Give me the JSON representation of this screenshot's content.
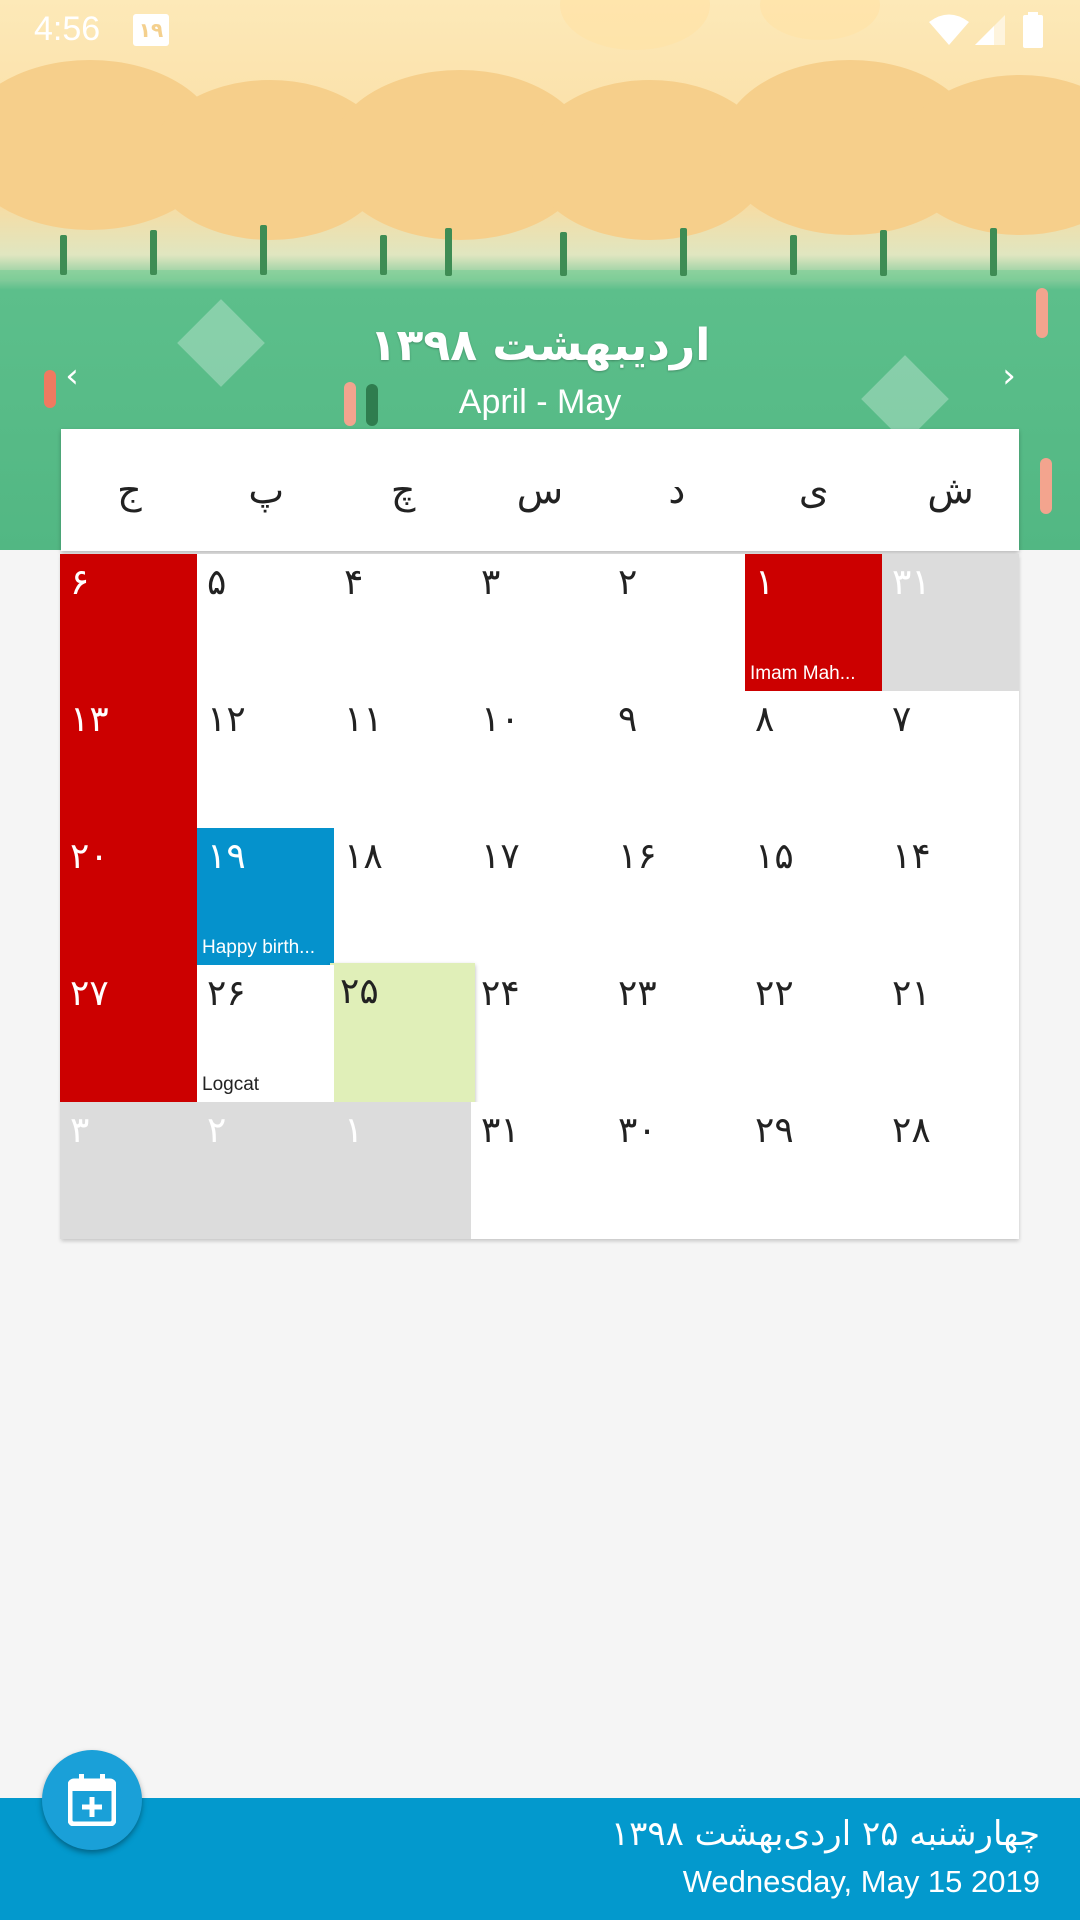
{
  "status_bar": {
    "time": "4:56",
    "date_badge": "۱۹",
    "icons": [
      "wifi-icon",
      "signal-icon",
      "battery-icon"
    ]
  },
  "header": {
    "title_persian": "اردیبهشت ۱۳۹۸",
    "subtitle": "April - May",
    "prev_icon": "chevron-left-icon",
    "next_icon": "chevron-right-icon"
  },
  "week_days": [
    "ش",
    "ی",
    "د",
    "س",
    "چ",
    "پ",
    "ج"
  ],
  "weeks": [
    [
      {
        "day": "۳۱",
        "type": "other"
      },
      {
        "day": "۱",
        "type": "holiday",
        "event": "Imam Mah..."
      },
      {
        "day": "۲"
      },
      {
        "day": "۳"
      },
      {
        "day": "۴"
      },
      {
        "day": "۵"
      },
      {
        "day": "۶",
        "type": "holiday"
      }
    ],
    [
      {
        "day": "۷"
      },
      {
        "day": "۸"
      },
      {
        "day": "۹"
      },
      {
        "day": "۱۰"
      },
      {
        "day": "۱۱"
      },
      {
        "day": "۱۲"
      },
      {
        "day": "۱۳",
        "type": "holiday"
      }
    ],
    [
      {
        "day": "۱۴"
      },
      {
        "day": "۱۵"
      },
      {
        "day": "۱۶"
      },
      {
        "day": "۱۷"
      },
      {
        "day": "۱۸"
      },
      {
        "day": "۱۹",
        "type": "birthday",
        "event": "Happy birth..."
      },
      {
        "day": "۲۰",
        "type": "holiday"
      }
    ],
    [
      {
        "day": "۲۱"
      },
      {
        "day": "۲۲"
      },
      {
        "day": "۲۳"
      },
      {
        "day": "۲۴"
      },
      {
        "day": "۲۵",
        "type": "today"
      },
      {
        "day": "۲۶",
        "type": "logcat",
        "event": "Logcat"
      },
      {
        "day": "۲۷",
        "type": "holiday"
      }
    ],
    [
      {
        "day": "۲۸"
      },
      {
        "day": "۲۹"
      },
      {
        "day": "۳۰"
      },
      {
        "day": "۳۱"
      },
      {
        "day": "۱",
        "type": "other"
      },
      {
        "day": "۲",
        "type": "other"
      },
      {
        "day": "۳",
        "type": "other"
      }
    ]
  ],
  "footer": {
    "persian_date": "چهارشنبه  ۲۵  اردی‌بهشت  ۱۳۹۸",
    "english_date": "Wednesday, May 15 2019"
  },
  "fab": {
    "icon": "calendar-add-icon"
  },
  "colors": {
    "holiday": "#cc0000",
    "birthday": "#0592cc",
    "today": "#e0efb8",
    "other_month": "#dcdcdc",
    "bottom_bar": "#0399cd"
  }
}
